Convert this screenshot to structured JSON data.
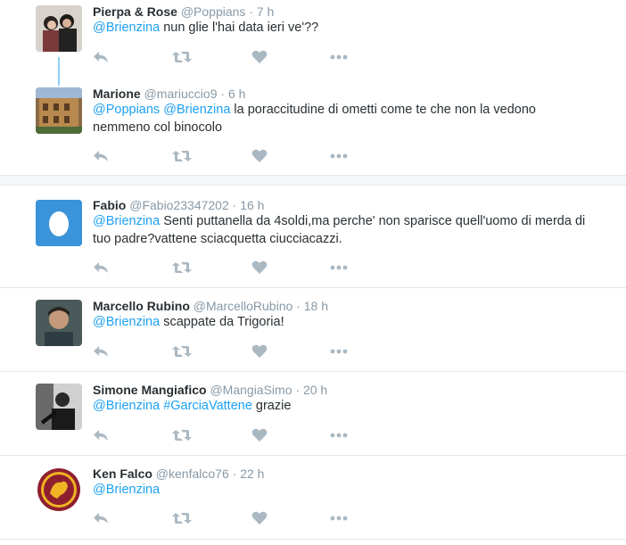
{
  "tweets": [
    {
      "name": "Pierpa & Rose",
      "handle": "@Poppians",
      "time": "7 h",
      "mentions": [
        "@Brienzina"
      ],
      "text": " nun glie l'hai data ieri ve'??",
      "avatar_icon": "couple-photo-avatar"
    },
    {
      "name": "Marione",
      "handle": "@mariuccio9",
      "time": "6 h",
      "mentions": [
        "@Poppians",
        "@Brienzina"
      ],
      "text": " la poraccitudine di ometti come te che non la vedono nemmeno col binocolo",
      "avatar_icon": "building-photo-avatar"
    },
    {
      "name": "Fabio",
      "handle": "@Fabio23347202",
      "time": "16 h",
      "mentions": [
        "@Brienzina"
      ],
      "text": " Senti puttanella da 4soldi,ma perche' non sparisce quell'uomo di merda di tuo padre?vattene sciacquetta ciucciacazzi.",
      "avatar_icon": "default-egg-avatar"
    },
    {
      "name": "Marcello Rubino",
      "handle": "@MarcelloRubino",
      "time": "18 h",
      "mentions": [
        "@Brienzina"
      ],
      "text": " scappate da Trigoria!",
      "avatar_icon": "person-photo-avatar"
    },
    {
      "name": "Simone Mangiafico",
      "handle": "@MangiaSimo",
      "time": "20 h",
      "mentions": [
        "@Brienzina"
      ],
      "hashtag": "#GarciaVattene",
      "text": " grazie",
      "avatar_icon": "bw-photo-avatar"
    },
    {
      "name": "Ken Falco",
      "handle": "@kenfalco76",
      "time": "22 h",
      "mentions": [
        "@Brienzina"
      ],
      "text": "",
      "avatar_icon": "as-roma-crest-avatar"
    }
  ],
  "dot": "·",
  "colors": {
    "link": "#1da1f2",
    "action_icon": "#aab8c2",
    "meta": "#8899a6",
    "egg_bg": "#3b94d9"
  },
  "action_icons": [
    "reply-icon",
    "retweet-icon",
    "like-icon",
    "more-icon"
  ]
}
